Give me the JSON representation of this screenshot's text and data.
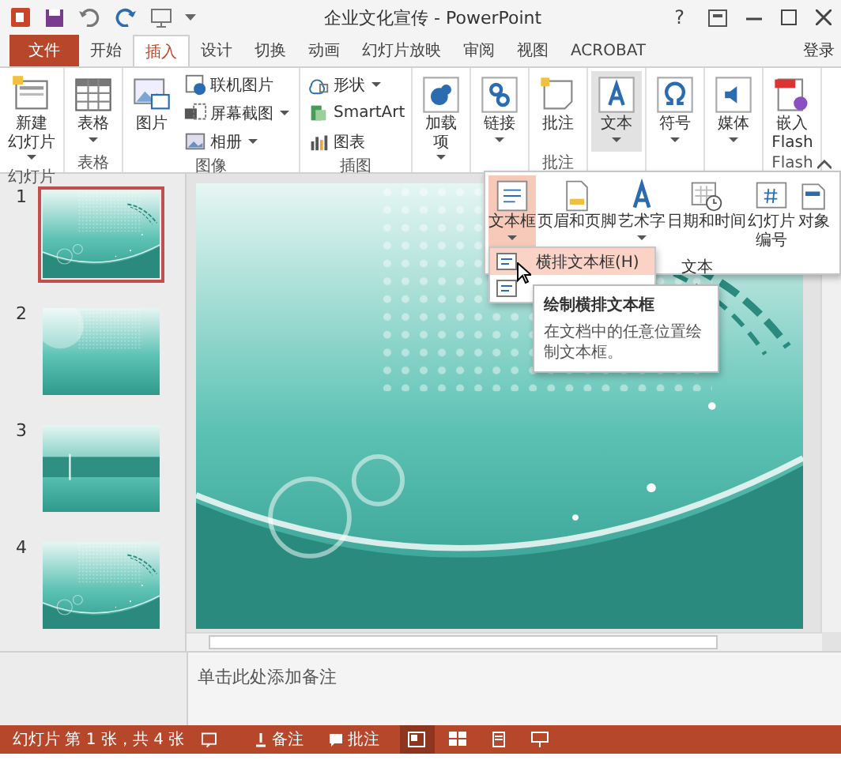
{
  "title_bar": {
    "title": "企业文化宣传 - PowerPoint",
    "help": "?"
  },
  "tabs": [
    {
      "label": "文件",
      "kind": "file",
      "selected": false
    },
    {
      "label": "开始",
      "kind": "tab",
      "selected": false
    },
    {
      "label": "插入",
      "kind": "tab",
      "selected": true
    },
    {
      "label": "设计",
      "kind": "tab",
      "selected": false
    },
    {
      "label": "切换",
      "kind": "tab",
      "selected": false
    },
    {
      "label": "动画",
      "kind": "tab",
      "selected": false
    },
    {
      "label": "幻灯片放映",
      "kind": "tab",
      "selected": false
    },
    {
      "label": "审阅",
      "kind": "tab",
      "selected": false
    },
    {
      "label": "视图",
      "kind": "tab",
      "selected": false
    },
    {
      "label": "ACROBAT",
      "kind": "tab",
      "selected": false
    }
  ],
  "account": "登录",
  "ribbon": [
    {
      "label": "幻灯片",
      "items": [
        {
          "kind": "large",
          "label": [
            "新建",
            "幻灯片"
          ],
          "dropdown": true,
          "pressed": false
        }
      ]
    },
    {
      "label": "表格",
      "items": [
        {
          "kind": "large",
          "label": "表格",
          "dropdown": true,
          "pressed": false
        }
      ]
    },
    {
      "label": "图像",
      "items": [
        {
          "kind": "large",
          "label": "图片",
          "dropdown": false,
          "pressed": false
        },
        {
          "kind": "small",
          "label": "联机图片",
          "dropdown": false,
          "pressed": false
        },
        {
          "kind": "small",
          "label": "屏幕截图",
          "dropdown": true,
          "pressed": false
        },
        {
          "kind": "small",
          "label": "相册",
          "dropdown": true,
          "pressed": false
        }
      ]
    },
    {
      "label": "插图",
      "items": [
        {
          "kind": "small",
          "label": "形状",
          "dropdown": true,
          "pressed": false
        },
        {
          "kind": "small",
          "label": "SmartArt",
          "dropdown": false,
          "pressed": false
        },
        {
          "kind": "small",
          "label": "图表",
          "dropdown": false,
          "pressed": false
        }
      ]
    },
    {
      "items": [
        {
          "kind": "large",
          "label": [
            "加载",
            "项"
          ],
          "dropdown": true,
          "pressed": false
        }
      ]
    },
    {
      "items": [
        {
          "kind": "large",
          "label": "链接",
          "dropdown": true,
          "pressed": false
        }
      ]
    },
    {
      "label": "批注",
      "items": [
        {
          "kind": "large",
          "label": "批注",
          "dropdown": false,
          "pressed": false
        }
      ]
    },
    {
      "items": [
        {
          "kind": "large",
          "label": "文本",
          "dropdown": true,
          "pressed": true
        }
      ]
    },
    {
      "items": [
        {
          "kind": "large",
          "label": "符号",
          "dropdown": true,
          "pressed": false
        }
      ]
    },
    {
      "items": [
        {
          "kind": "large",
          "label": "媒体",
          "dropdown": true,
          "pressed": false
        }
      ]
    },
    {
      "label": "Flash",
      "items": [
        {
          "kind": "large",
          "label": [
            "嵌入",
            "Flash"
          ],
          "dropdown": false,
          "pressed": false
        }
      ]
    }
  ],
  "text_gallery": {
    "label": "文本",
    "buttons": [
      {
        "label": "文本框",
        "dropdown": true,
        "selected": true
      },
      {
        "label": "页眉和页脚",
        "dropdown": false,
        "selected": false
      },
      {
        "label": "艺术字",
        "dropdown": true,
        "selected": false
      },
      {
        "label": "日期和时间",
        "dropdown": false,
        "selected": false
      },
      {
        "label": [
          "幻灯片",
          "编号"
        ],
        "dropdown": false,
        "selected": false
      },
      {
        "label": "对象",
        "dropdown": false,
        "selected": false
      }
    ]
  },
  "text_box_menu": [
    {
      "label": "横排文本框(H)",
      "selected": true
    },
    {
      "selected": false
    }
  ],
  "tooltip": {
    "title": "绘制横排文本框",
    "body": "在文档中的任意位置绘制文本框。"
  },
  "slides": [
    {
      "number": "1",
      "selected": true
    },
    {
      "number": "2",
      "selected": false
    },
    {
      "number": "3",
      "selected": false
    },
    {
      "number": "4",
      "selected": false
    }
  ],
  "notes": {
    "prompt": "单击此处添加备注"
  },
  "status_bar": {
    "slide_info": "幻灯片 第 1 张，共 4 张",
    "notes": "备注",
    "comments": "批注",
    "views": [
      {
        "selected": true
      },
      {
        "selected": false
      },
      {
        "selected": false
      },
      {
        "selected": false
      }
    ]
  }
}
